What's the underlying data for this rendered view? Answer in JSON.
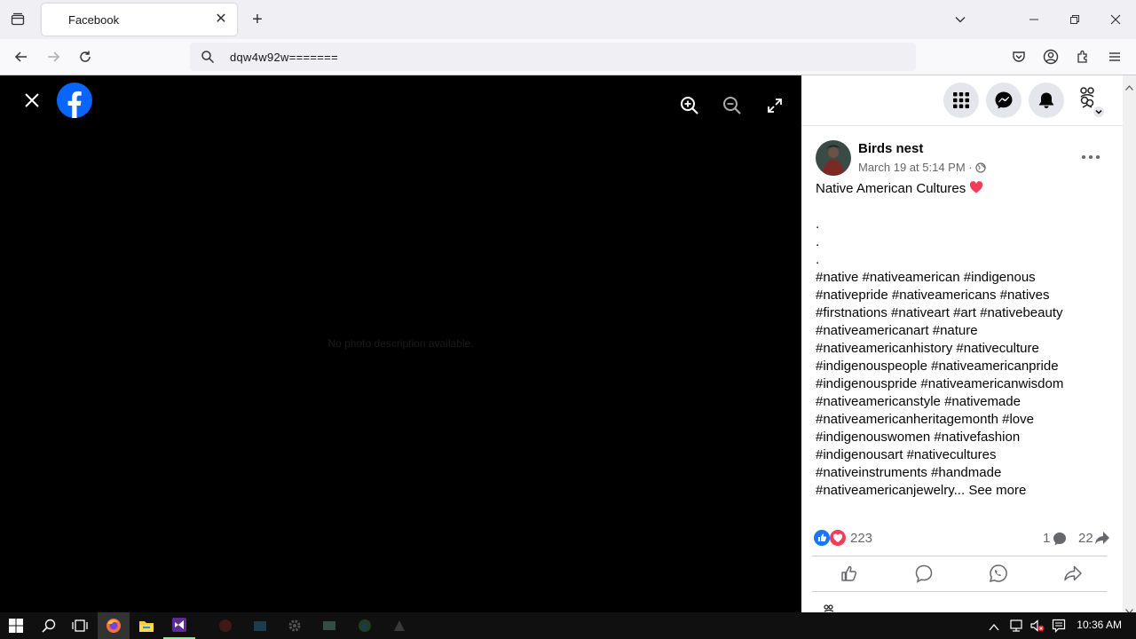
{
  "browser": {
    "tab_title": "Facebook",
    "url": "dqw4w92w======="
  },
  "viewer": {
    "no_description": "No photo description available."
  },
  "post": {
    "author": "Birds nest",
    "date": "March 19 at 5:14 PM",
    "privacy_separator": "·",
    "text_lines": [
      "Native American Cultures",
      "",
      ".",
      ".",
      ".",
      "#native #nativeamerican #indigenous",
      "#nativepride #nativeamericans #natives",
      "#firstnations #nativeart #art #nativebeauty",
      "#nativeamericanart #nature",
      "#nativeamericanhistory #nativeculture",
      "#indigenouspeople #nativeamericanpride",
      "#indigenouspride #nativeamericanwisdom",
      "#nativeamericanstyle #nativemade",
      "#nativeamericanheritagemonth #love",
      "#indigenouswomen #nativefashion",
      "#indigenousart #nativecultures",
      "#nativeinstruments #handmade",
      "#nativeamericanjewelry..."
    ],
    "see_more": "See more",
    "reactions_count": "223",
    "comments_count": "1",
    "shares_count": "22"
  },
  "taskbar": {
    "time": "10:36 AM"
  },
  "colors": {
    "facebook_blue": "#0866ff",
    "love_red": "#f33e58",
    "like_blue": "#1877f2"
  }
}
